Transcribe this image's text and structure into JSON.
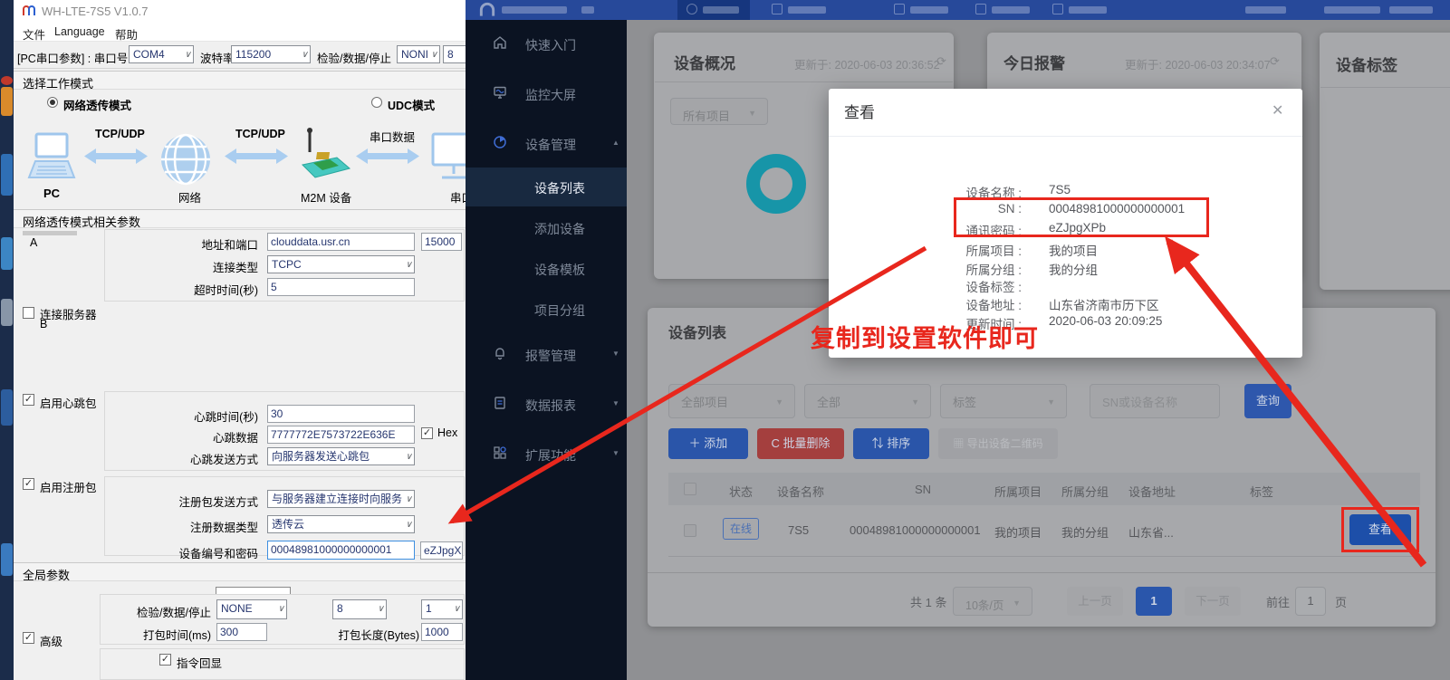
{
  "left_app": {
    "title": "WH-LTE-7S5 V1.0.7",
    "menu": [
      "文件",
      "Language",
      "帮助"
    ],
    "toolbar": {
      "label": "[PC串口参数] : 串口号",
      "com_port": "COM4",
      "baud_label": "波特率",
      "baud": "115200",
      "parity_label": "检验/数据/停止",
      "parity": "NONI",
      "data_bits": "8"
    },
    "work_mode": {
      "header": "选择工作模式",
      "net_mode": "网络透传模式",
      "udc_mode": "UDC模式"
    },
    "diagram": {
      "pc_label": "PC",
      "net_label": "网络",
      "m2m_label": "M2M 设备",
      "serial_label": "串口设",
      "link1": "TCP/UDP",
      "link2": "TCP/UDP",
      "link3": "串口数据"
    },
    "net_params": {
      "header": "网络透传模式相关参数",
      "server_a": "A",
      "addr_label": "地址和端口",
      "addr": "clouddata.usr.cn",
      "port": "15000",
      "conn_type_label": "连接类型",
      "conn_type": "TCPC",
      "timeout_label": "超时时间(秒)",
      "timeout": "5",
      "server_b_line1": "连接服务器",
      "server_b_line2": "B"
    },
    "heartbeat": {
      "enable": "启用心跳包",
      "time_label": "心跳时间(秒)",
      "time": "30",
      "data_label": "心跳数据",
      "data": "7777772E7573722E636E",
      "hex": "Hex",
      "mode_label": "心跳发送方式",
      "mode": "向服务器发送心跳包"
    },
    "register": {
      "enable": "启用注册包",
      "mode_label": "注册包发送方式",
      "mode": "与服务器建立连接时向服务",
      "type_label": "注册数据类型",
      "type": "透传云",
      "id_label": "设备编号和密码",
      "device_id": "00048981000000000001",
      "password": "eZJpgXPb"
    },
    "global_params": {
      "header": "全局参数",
      "parity_label": "检验/数据/停止",
      "parity": "NONE",
      "data_bits": "8",
      "stop_bits": "1",
      "pack_time_label": "打包时间(ms)",
      "pack_time": "300",
      "pack_len_label": "打包长度(Bytes)",
      "pack_len": "1000",
      "advanced": "高级",
      "echo": "指令回显"
    }
  },
  "web_app": {
    "sidebar": {
      "items": [
        {
          "label": "快速入门"
        },
        {
          "label": "监控大屏"
        },
        {
          "label": "设备管理"
        },
        {
          "label": "设备列表"
        },
        {
          "label": "添加设备"
        },
        {
          "label": "设备模板"
        },
        {
          "label": "项目分组"
        },
        {
          "label": "报警管理"
        },
        {
          "label": "数据报表"
        },
        {
          "label": "扩展功能"
        }
      ]
    },
    "overview_card": {
      "title": "设备概况",
      "updated": "更新于: 2020-06-03 20:36:52",
      "project_filter": "所有项目",
      "ring_color": "#1795a8"
    },
    "alarm_card": {
      "title": "今日报警",
      "updated": "更新于: 2020-06-03 20:34:07"
    },
    "tag_card": {
      "title": "设备标签"
    },
    "device_list": {
      "title": "设备列表",
      "filters": {
        "project": "全部项目",
        "status": "全部",
        "tag": "标签",
        "search_placeholder": "SN或设备名称",
        "search_button": "查询"
      },
      "actions": {
        "add": "添加",
        "batch_delete": "批量删除",
        "sort": "排序",
        "export_qr": "导出设备二维码"
      },
      "table": {
        "headers": [
          "状态",
          "设备名称",
          "SN",
          "所属项目",
          "所属分组",
          "设备地址",
          "标签"
        ],
        "row": {
          "status": "在线",
          "name": "7S5",
          "sn": "00048981000000000001",
          "project": "我的项目",
          "group": "我的分组",
          "address": "山东省...",
          "action": "查看"
        }
      },
      "pagination": {
        "total": "共 1 条",
        "page_size": "10条/页",
        "prev": "上一页",
        "page": "1",
        "next": "下一页",
        "goto_label": "前往",
        "goto_value": "1",
        "unit": "页"
      }
    },
    "modal": {
      "title": "查看",
      "rows": [
        {
          "label": "设备名称 :",
          "value": "7S5"
        },
        {
          "label": "SN :",
          "value": "00048981000000000001"
        },
        {
          "label": "通讯密码 :",
          "value": "eZJpgXPb"
        },
        {
          "label": "所属项目 :",
          "value": "我的项目"
        },
        {
          "label": "所属分组 :",
          "value": "我的分组"
        },
        {
          "label": "设备标签 :",
          "value": ""
        },
        {
          "label": "设备地址 :",
          "value": "山东省济南市历下区"
        },
        {
          "label": "更新时间 :",
          "value": "2020-06-03 20:09:25"
        }
      ]
    }
  },
  "annotations": {
    "hint_text": "复制到设置软件即可",
    "color": "#e8271d"
  }
}
